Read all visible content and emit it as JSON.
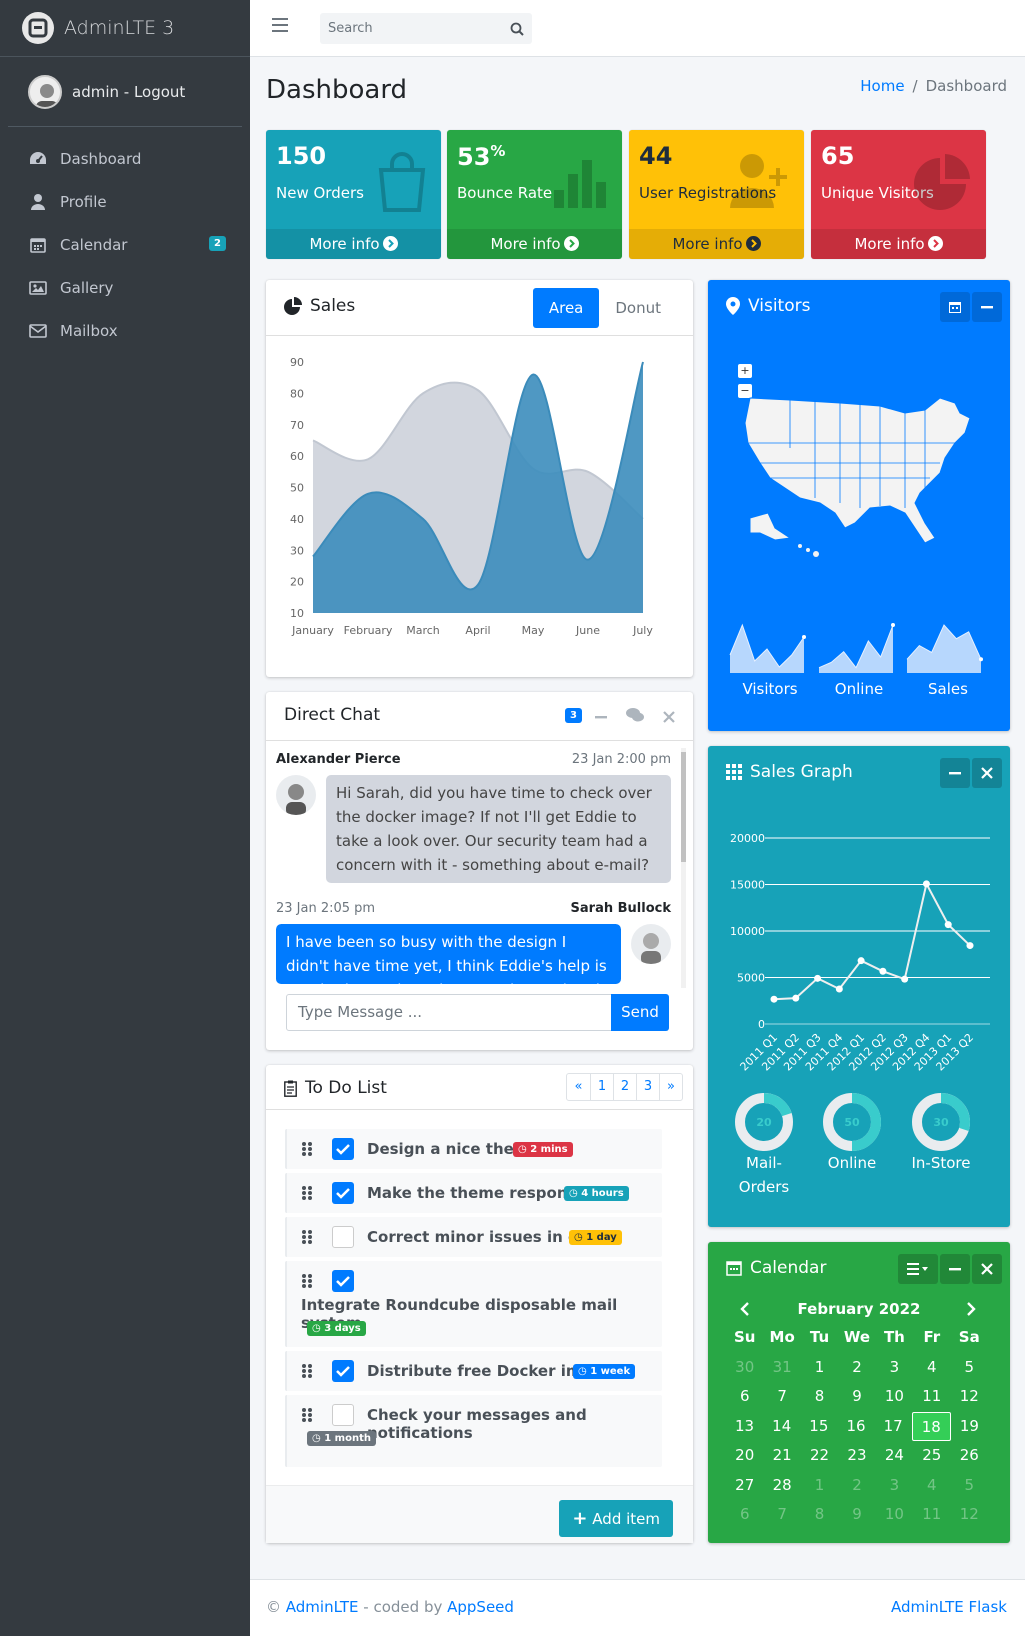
{
  "brand": {
    "name": "AdminLTE 3"
  },
  "user": {
    "label": "admin - Logout"
  },
  "sidebar": {
    "items": [
      {
        "label": "Dashboard",
        "icon": "tachometer-icon"
      },
      {
        "label": "Profile",
        "icon": "user-icon"
      },
      {
        "label": "Calendar",
        "icon": "calendar-icon",
        "badge": "2"
      },
      {
        "label": "Gallery",
        "icon": "image-icon"
      },
      {
        "label": "Mailbox",
        "icon": "envelope-icon"
      }
    ]
  },
  "search": {
    "placeholder": "Search"
  },
  "page": {
    "title": "Dashboard",
    "breadcrumb_home": "Home",
    "breadcrumb_current": "Dashboard"
  },
  "stats": [
    {
      "value": "150",
      "suffix": "",
      "label": "New Orders",
      "more": "More info",
      "color": "#17a2b8",
      "icon": "shopping-bag-icon"
    },
    {
      "value": "53",
      "suffix": "%",
      "label": "Bounce Rate",
      "more": "More info",
      "color": "#28a745",
      "icon": "bar-chart-icon"
    },
    {
      "value": "44",
      "suffix": "",
      "label": "User Registrations",
      "more": "More info",
      "color": "#ffc107",
      "icon": "user-plus-icon"
    },
    {
      "value": "65",
      "suffix": "",
      "label": "Unique Visitors",
      "more": "More info",
      "color": "#dc3545",
      "icon": "pie-chart-icon"
    }
  ],
  "sales": {
    "title": "Sales",
    "tab_area": "Area",
    "tab_donut": "Donut"
  },
  "chart_data": [
    {
      "type": "area",
      "categories": [
        "January",
        "February",
        "March",
        "April",
        "May",
        "June",
        "July"
      ],
      "series": [
        {
          "values": [
            65,
            59,
            80,
            81,
            56,
            55,
            40
          ],
          "color": "#d2d6de"
        },
        {
          "values": [
            28,
            48,
            40,
            19,
            86,
            27,
            90
          ],
          "color": "#3c8dbc"
        }
      ],
      "yticks": [
        "10",
        "20",
        "30",
        "40",
        "50",
        "60",
        "70",
        "80",
        "90"
      ],
      "ylim": [
        10,
        90
      ]
    },
    {
      "type": "line",
      "categories": [
        "2011 Q1",
        "2011 Q2",
        "2011 Q3",
        "2011 Q4",
        "2012 Q1",
        "2012 Q2",
        "2012 Q3",
        "2012 Q4",
        "2013 Q1",
        "2013 Q2"
      ],
      "values": [
        2666,
        2778,
        4912,
        3767,
        6810,
        5670,
        4820,
        15073,
        10687,
        8432
      ],
      "yticks": [
        "20000",
        "15000",
        "10000",
        "5000",
        "0"
      ],
      "ylim": [
        0,
        20000
      ]
    }
  ],
  "visitors": {
    "title": "Visitors",
    "zoom_in": "+",
    "zoom_out": "−",
    "sparks": [
      {
        "label": "Visitors",
        "values": [
          3,
          8,
          2,
          4,
          1,
          3,
          6
        ]
      },
      {
        "label": "Online",
        "values": [
          1,
          2,
          4,
          1,
          6,
          3,
          9
        ]
      },
      {
        "label": "Sales",
        "values": [
          2,
          4,
          3,
          7,
          5,
          6,
          2
        ]
      }
    ]
  },
  "chat": {
    "title": "Direct Chat",
    "badge": "3",
    "msg1": {
      "name": "Alexander Pierce",
      "time": "23 Jan 2:00 pm",
      "text": "Hi Sarah, did you have time to check over the docker image? If not I'll get Eddie to take a look over. Our security team had a concern with it - something about e-mail?"
    },
    "msg2": {
      "name": "Sarah Bullock",
      "time": "23 Jan 2:05 pm",
      "text": "I have been so busy with the design I didn't have time yet, I think Eddie's help is required! Our demo is currently restricted to invite only."
    },
    "input_placeholder": "Type Message ...",
    "send": "Send"
  },
  "todo": {
    "title": "To Do List",
    "pages": [
      "«",
      "1",
      "2",
      "3",
      "»"
    ],
    "items": [
      {
        "text": "Design a nice theme",
        "badge": "2 mins",
        "color": "#dc3545",
        "checked": true
      },
      {
        "text": "Make the theme responsive",
        "badge": "4 hours",
        "color": "#17a2b8",
        "checked": true
      },
      {
        "text": "Correct minor issues in code",
        "badge": "1 day",
        "color": "#ffc107",
        "checked": false
      },
      {
        "text": "Integrate Roundcube disposable mail system",
        "badge": "3 days",
        "color": "#28a745",
        "checked": true
      },
      {
        "text": "Distribute free Docker image",
        "badge": "1 week",
        "color": "#007bff",
        "checked": true
      },
      {
        "text": "Check your messages and notifications",
        "badge": "1 month",
        "color": "#6c757d",
        "checked": false
      }
    ],
    "add": "Add item"
  },
  "salesgraph": {
    "title": "Sales Graph",
    "knobs": [
      {
        "value": "20",
        "label_a": "Mail-",
        "label_b": "Orders",
        "level": 0.2
      },
      {
        "value": "50",
        "label_a": "Online",
        "label_b": "",
        "level": 0.5
      },
      {
        "value": "30",
        "label_a": "In-Store",
        "label_b": "",
        "level": 0.3
      }
    ]
  },
  "calendar": {
    "title": "Calendar",
    "month": "February 2022",
    "days": [
      "Su",
      "Mo",
      "Tu",
      "We",
      "Th",
      "Fr",
      "Sa"
    ],
    "weeks": [
      [
        "30",
        "31",
        "1",
        "2",
        "3",
        "4",
        "5"
      ],
      [
        "6",
        "7",
        "8",
        "9",
        "10",
        "11",
        "12"
      ],
      [
        "13",
        "14",
        "15",
        "16",
        "17",
        "18",
        "19"
      ],
      [
        "20",
        "21",
        "22",
        "23",
        "24",
        "25",
        "26"
      ],
      [
        "27",
        "28",
        "1",
        "2",
        "3",
        "4",
        "5"
      ],
      [
        "6",
        "7",
        "8",
        "9",
        "10",
        "11",
        "12"
      ]
    ],
    "today": "18"
  },
  "footer": {
    "copy": "©",
    "brand": "AdminLTE",
    "coded": " - coded by ",
    "author": "AppSeed",
    "right": "AdminLTE Flask"
  }
}
